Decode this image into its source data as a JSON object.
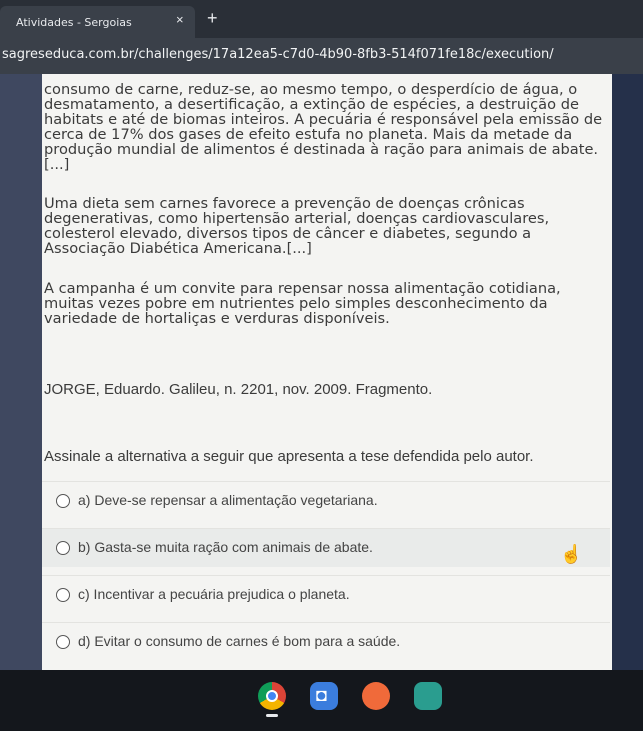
{
  "browser": {
    "tab_title": "Atividades - Sergoias",
    "tab_close": "×",
    "new_tab": "+",
    "url": "sagreseduca.com.br/challenges/17a12ea5-c7d0-4b90-8fb3-514f071fe18c/execution/"
  },
  "text": {
    "paragraph1": "consumo de carne, reduz-se, ao mesmo tempo, o desperdício de água, o desmatamento, a desertificação, a extinção de espécies, a destruição de habitats e até de biomas inteiros. A pecuária é responsável pela emissão de cerca de 17% dos gases de efeito estufa no planeta. Mais da metade da produção mundial de alimentos é destinada à ração para animais de abate. [...]",
    "paragraph2": "Uma dieta sem carnes favorece a prevenção de doenças crônicas degenerativas, como hipertensão arterial, doenças cardiovasculares, colesterol elevado, diversos tipos de câncer e diabetes, segundo a Associação Diabética Americana.[...]",
    "paragraph3": "A campanha é um convite para repensar nossa alimentação cotidiana, muitas vezes pobre em nutrientes pelo simples desconhecimento da variedade de hortaliças e verduras disponíveis.",
    "reference": "JORGE, Eduardo. Galileu, n. 2201, nov. 2009. Fragmento.",
    "question": "Assinale a alternativa a seguir que apresenta a tese defendida pelo autor."
  },
  "options": [
    {
      "label": "a) Deve-se repensar a alimentação vegetariana."
    },
    {
      "label": "b) Gasta-se muita ração com animais de abate."
    },
    {
      "label": "c) Incentivar a pecuária prejudica o planeta."
    },
    {
      "label": "d) Evitar o consumo de carnes é bom para a saúde."
    }
  ],
  "icons": {
    "cursor": "hand-pointer-icon",
    "taskbar": [
      "chrome-icon",
      "files-icon",
      "palette-icon",
      "slides-icon"
    ]
  },
  "colors": {
    "page_background": "#f4f4f2",
    "chrome_tab": "#3a4049",
    "taskbar": "#14171c"
  }
}
